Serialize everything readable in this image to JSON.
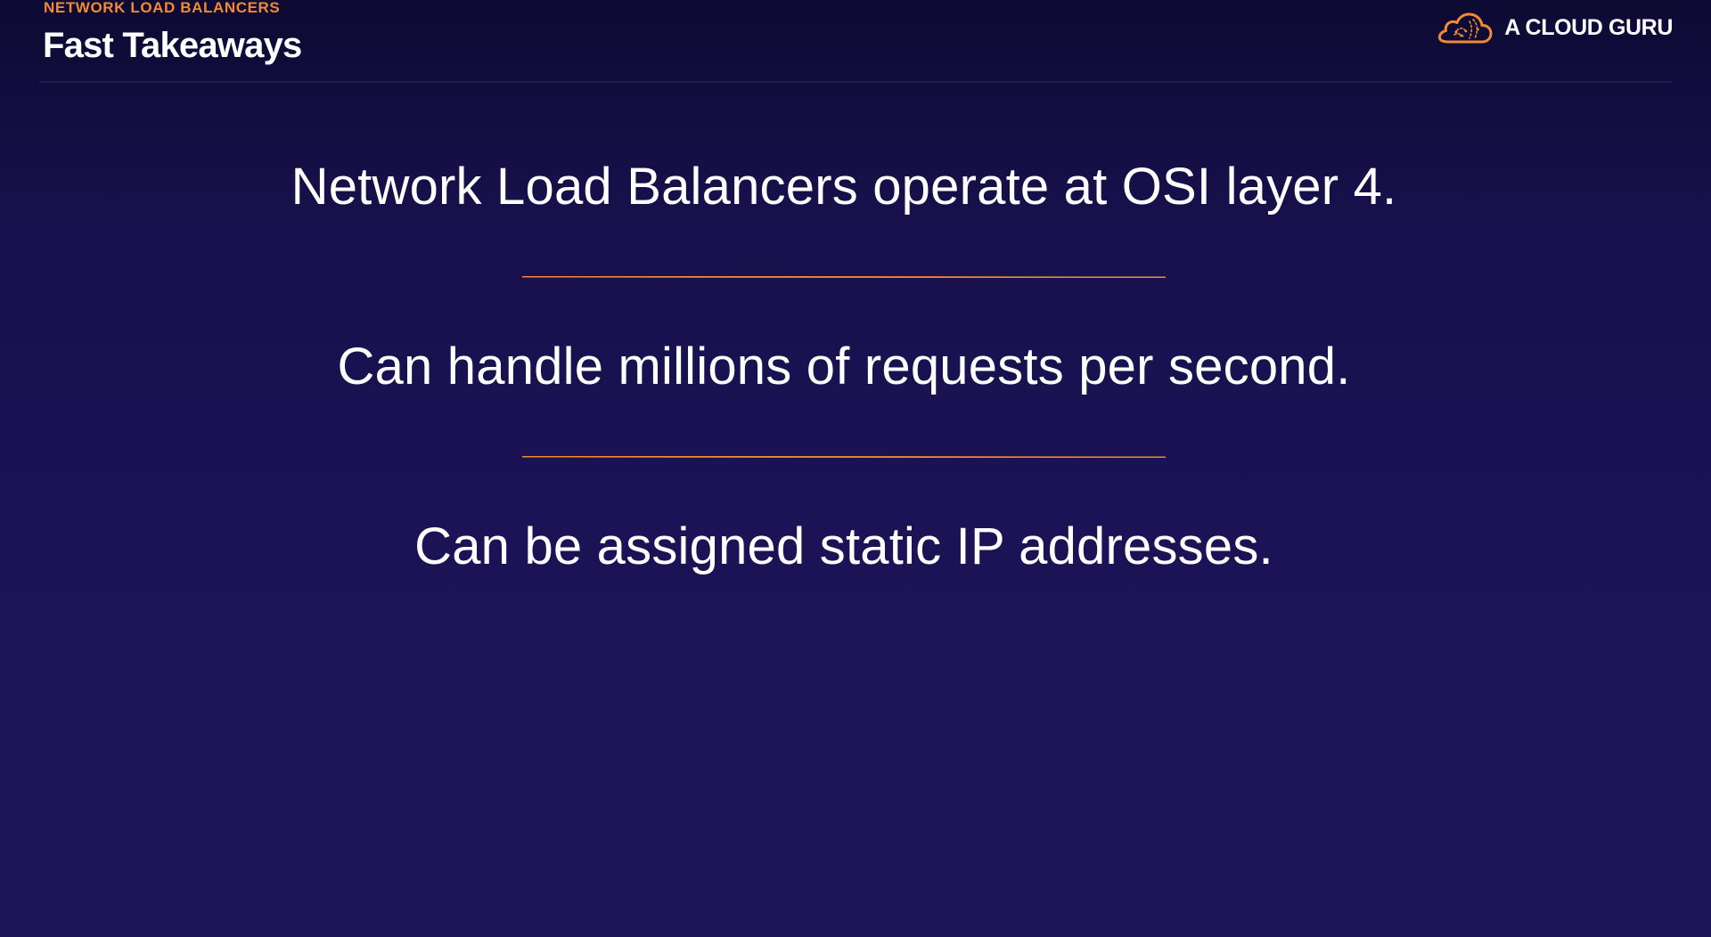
{
  "header": {
    "eyebrow": "NETWORK LOAD BALANCERS",
    "title": "Fast Takeaways"
  },
  "brand": {
    "name": "A CLOUD GURU",
    "logo_icon": "cloud-logo-icon"
  },
  "takeaways": [
    "Network Load Balancers operate at OSI layer 4.",
    "Can handle millions of requests per second.",
    "Can be assigned static IP addresses."
  ],
  "colors": {
    "background_top": "#0d0a33",
    "background_bottom": "#1d1558",
    "accent": "#f08a33",
    "text": "#ffffff"
  }
}
